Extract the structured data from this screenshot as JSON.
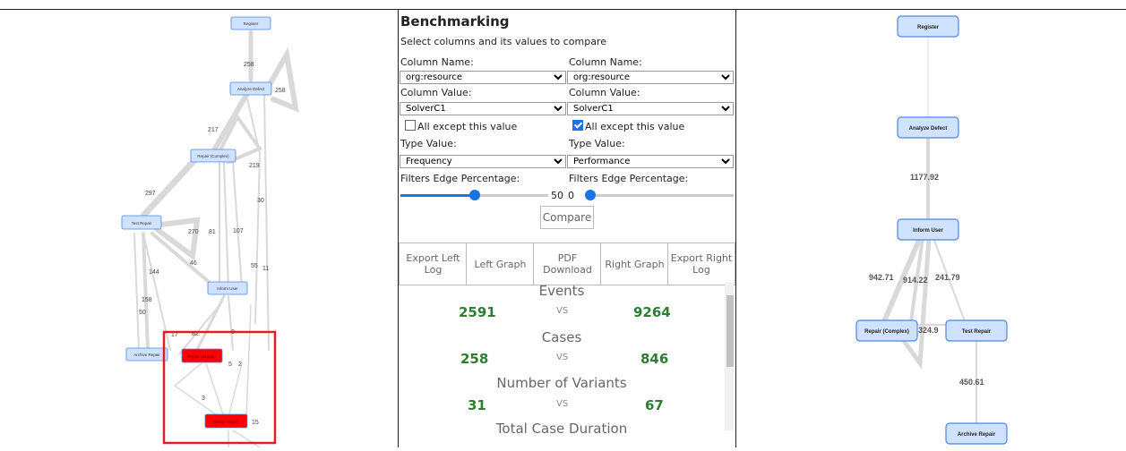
{
  "benchmarking": {
    "title": "Benchmarking",
    "subtitle": "Select columns and its values to compare",
    "left": {
      "column_name_label": "Column Name:",
      "column_name": "org:resource",
      "column_value_label": "Column Value:",
      "column_value": "SolverC1",
      "except_label": "All except this value",
      "except_checked": false,
      "type_value_label": "Type Value:",
      "type_value": "Frequency",
      "filters_label": "Filters Edge Percentage:",
      "slider_value": "50",
      "slider_fraction": 0.5
    },
    "right": {
      "column_name_label": "Column Name:",
      "column_name": "org:resource",
      "column_value_label": "Column Value:",
      "column_value": "SolverC1",
      "except_label": "All except this value",
      "except_checked": true,
      "type_value_label": "Type Value:",
      "type_value": "Performance",
      "filters_label": "Filters Edge Percentage:",
      "slider_value": "0",
      "slider_fraction": 0.0
    },
    "compare_button": "Compare",
    "actions": {
      "export_left_log_1": "Export Left",
      "export_left_log_2": "Log",
      "left_graph": "Left Graph",
      "pdf_download_1": "PDF",
      "pdf_download_2": "Download",
      "right_graph": "Right Graph",
      "export_right_log_1": "Export Right",
      "export_right_log_2": "Log"
    },
    "stats": {
      "vs": "VS",
      "events": {
        "label": "Events",
        "left": "2591",
        "right": "9264"
      },
      "cases": {
        "label": "Cases",
        "left": "258",
        "right": "846"
      },
      "variants": {
        "label": "Number of Variants",
        "left": "31",
        "right": "67"
      },
      "duration": {
        "label": "Total Case Duration"
      }
    }
  },
  "left_graph": {
    "nodes": {
      "register": "Register",
      "analyze_defect": "Analyze Defect",
      "repair_complex": "Repair (Complex)",
      "test_repair": "Test Repair",
      "inform_user": "Inform User",
      "archive_repair": "Archive Repair",
      "repair_simple": "Repair (Simple)",
      "restart_repair": "Restart Repair"
    },
    "edge_labels": {
      "e1": "258",
      "e2": "258",
      "e3": "217",
      "e4": "219",
      "e5": "297",
      "e6": "30",
      "e7": "270",
      "e8": "81",
      "e9": "107",
      "e10": "46",
      "e11": "55",
      "e12": "11",
      "e13": "144",
      "e14": "158",
      "e15": "50",
      "e16": "17",
      "e17": "82",
      "e18": "8",
      "e19": "5",
      "e20": "2",
      "e21": "3",
      "e22": "15"
    },
    "highlight_color": "#ff0000",
    "node_color": "#cfe2ff",
    "selection_box_color": "#e02020"
  },
  "right_graph": {
    "nodes": {
      "register": "Register",
      "analyze_defect": "Analyze Defect",
      "inform_user": "Inform User",
      "repair_complex": "Repair (Complex)",
      "test_repair": "Test Repair",
      "archive_repair": "Archive Repair"
    },
    "edge_labels": {
      "e1": "1177.92",
      "e2": "942.71",
      "e3": "914.22",
      "e4": "241.79",
      "e5": "324.9",
      "e6": "450.61"
    }
  }
}
